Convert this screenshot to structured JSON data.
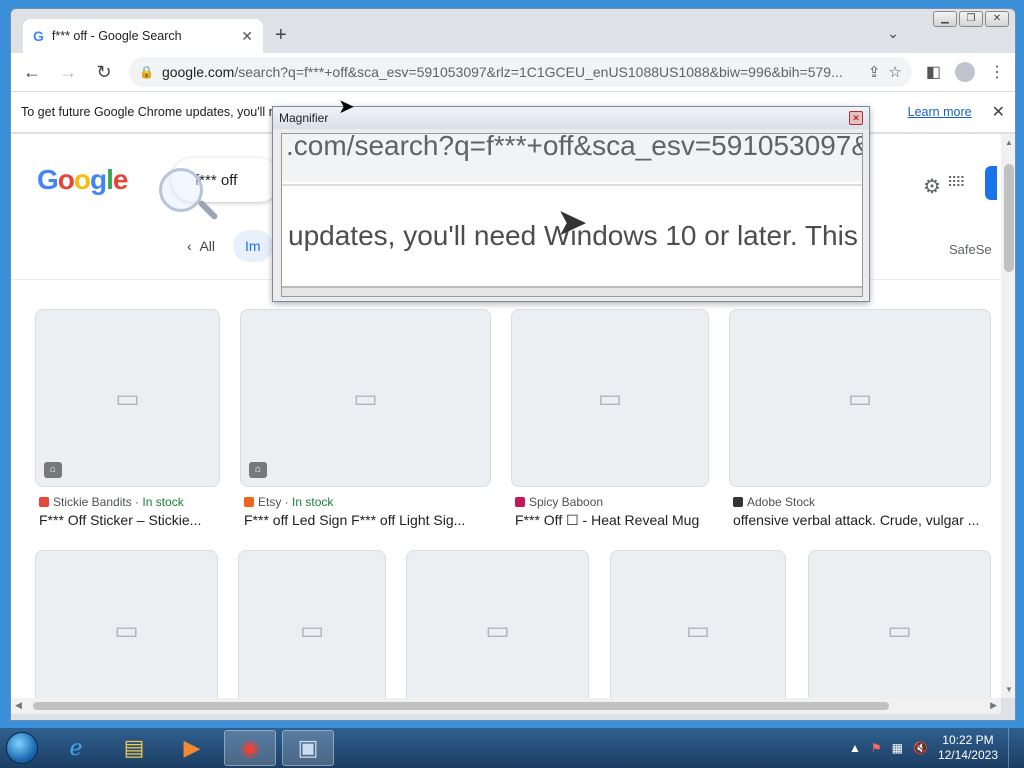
{
  "browser": {
    "tab_title": "f*** off - Google Search",
    "tab_icon": "G",
    "url_host": "google.com",
    "url_rest": "/search?q=f***+off&sca_esv=591053097&rlz=1C1GCEU_enUS1088US1088&biw=996&bih=579...",
    "info_message": "To get future Google Chrome updates, you'll need Windows 10 or later. This computer is using Windows 7.",
    "learn_more": "Learn more"
  },
  "google": {
    "logo": [
      "G",
      "o",
      "o",
      "g",
      "l",
      "e"
    ],
    "query": "f*** off",
    "chip_all": "All",
    "chip_images": "Im",
    "safesearch": "SafeSe"
  },
  "results": [
    {
      "source": "Stickie Bandits",
      "stock": "In stock",
      "title": "F*** Off Sticker – Stickie...",
      "fav": "#e8453c"
    },
    {
      "source": "Etsy",
      "stock": "In stock",
      "title": "F*** off Led Sign F*** off Light Sig...",
      "fav": "#f1641e"
    },
    {
      "source": "Spicy Baboon",
      "stock": "",
      "title": "F*** Off ☐ - Heat Reveal Mug",
      "fav": "#c2185b"
    },
    {
      "source": "Adobe Stock",
      "stock": "",
      "title": "offensive verbal attack. Crude, vulgar ...",
      "fav": "#333333"
    }
  ],
  "magnifier": {
    "title": "Magnifier",
    "line1": ".com/search?q=f***+off&sca_esv=591053097&",
    "line2": "updates, you'll need Windows 10 or later. This com"
  },
  "taskbar": {
    "time": "10:22 PM",
    "date": "12/14/2023"
  }
}
